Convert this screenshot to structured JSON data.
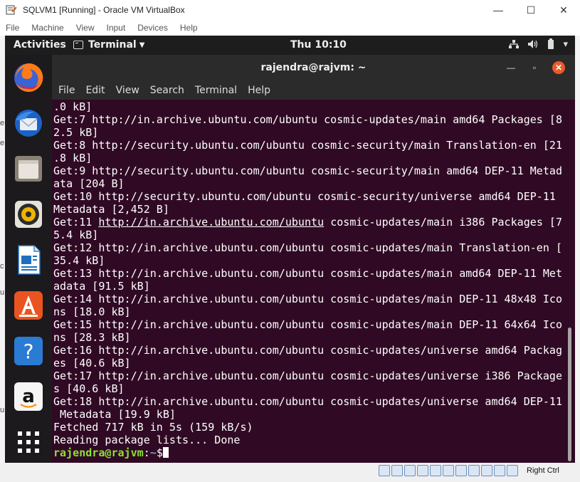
{
  "host_window": {
    "title": "SQLVM1 [Running] - Oracle VM VirtualBox",
    "controls": {
      "minimize": "—",
      "maximize": "☐",
      "close": "✕"
    },
    "menu": [
      "File",
      "Machine",
      "View",
      "Input",
      "Devices",
      "Help"
    ],
    "host_key_label": "Right Ctrl"
  },
  "gnome": {
    "activities": "Activities",
    "app_menu": "Terminal",
    "app_menu_caret": "▼",
    "clock": "Thu 10:10",
    "tray": {
      "network": "⇵",
      "volume": "🔊",
      "battery": "▮",
      "menu": "▾"
    }
  },
  "dock": {
    "items": [
      "firefox-icon",
      "thunderbird-icon",
      "files-icon",
      "rhythmbox-icon",
      "libreoffice-writer-icon",
      "ubuntu-software-icon",
      "help-icon",
      "amazon-icon",
      "show-applications-icon"
    ],
    "help_glyph": "?",
    "amazon_glyph": "a"
  },
  "terminal": {
    "title": "rajendra@rajvm: ~",
    "controls": {
      "minimize": "—",
      "maximize": "▫",
      "close": "✕"
    },
    "menu": [
      "File",
      "Edit",
      "View",
      "Search",
      "Terminal",
      "Help"
    ],
    "lines": [
      ".0 kB]",
      "Get:7 http://in.archive.ubuntu.com/ubuntu cosmic-updates/main amd64 Packages [8",
      "2.5 kB]",
      "Get:8 http://security.ubuntu.com/ubuntu cosmic-security/main Translation-en [21",
      ".8 kB]",
      "Get:9 http://security.ubuntu.com/ubuntu cosmic-security/main amd64 DEP-11 Metad",
      "ata [204 B]",
      "Get:10 http://security.ubuntu.com/ubuntu cosmic-security/universe amd64 DEP-11",
      "Metadata [2,452 B]"
    ],
    "line11_prefix": "Get:11 ",
    "line11_link": "http://in.archive.ubuntu.com/ubuntu",
    "line11_suffix": " cosmic-updates/main i386 Packages [7",
    "lines_after": [
      "5.4 kB]",
      "Get:12 http://in.archive.ubuntu.com/ubuntu cosmic-updates/main Translation-en [",
      "35.4 kB]",
      "Get:13 http://in.archive.ubuntu.com/ubuntu cosmic-updates/main amd64 DEP-11 Met",
      "adata [91.5 kB]",
      "Get:14 http://in.archive.ubuntu.com/ubuntu cosmic-updates/main DEP-11 48x48 Ico",
      "ns [18.0 kB]",
      "Get:15 http://in.archive.ubuntu.com/ubuntu cosmic-updates/main DEP-11 64x64 Ico",
      "ns [28.3 kB]",
      "Get:16 http://in.archive.ubuntu.com/ubuntu cosmic-updates/universe amd64 Packag",
      "es [40.6 kB]",
      "Get:17 http://in.archive.ubuntu.com/ubuntu cosmic-updates/universe i386 Package",
      "s [40.6 kB]",
      "Get:18 http://in.archive.ubuntu.com/ubuntu cosmic-updates/universe amd64 DEP-11",
      " Metadata [19.9 kB]",
      "Fetched 717 kB in 5s (159 kB/s)",
      "Reading package lists... Done"
    ],
    "prompt_user": "rajendra@rajvm",
    "prompt_sep": ":",
    "prompt_path": "~",
    "prompt_dollar": "$",
    "colors": {
      "background": "#300a24",
      "prompt_user": "#8ae234",
      "prompt_path": "#729fcf"
    }
  },
  "host_sliver_chars": [
    "e",
    "e",
    "c",
    "u",
    "u"
  ]
}
